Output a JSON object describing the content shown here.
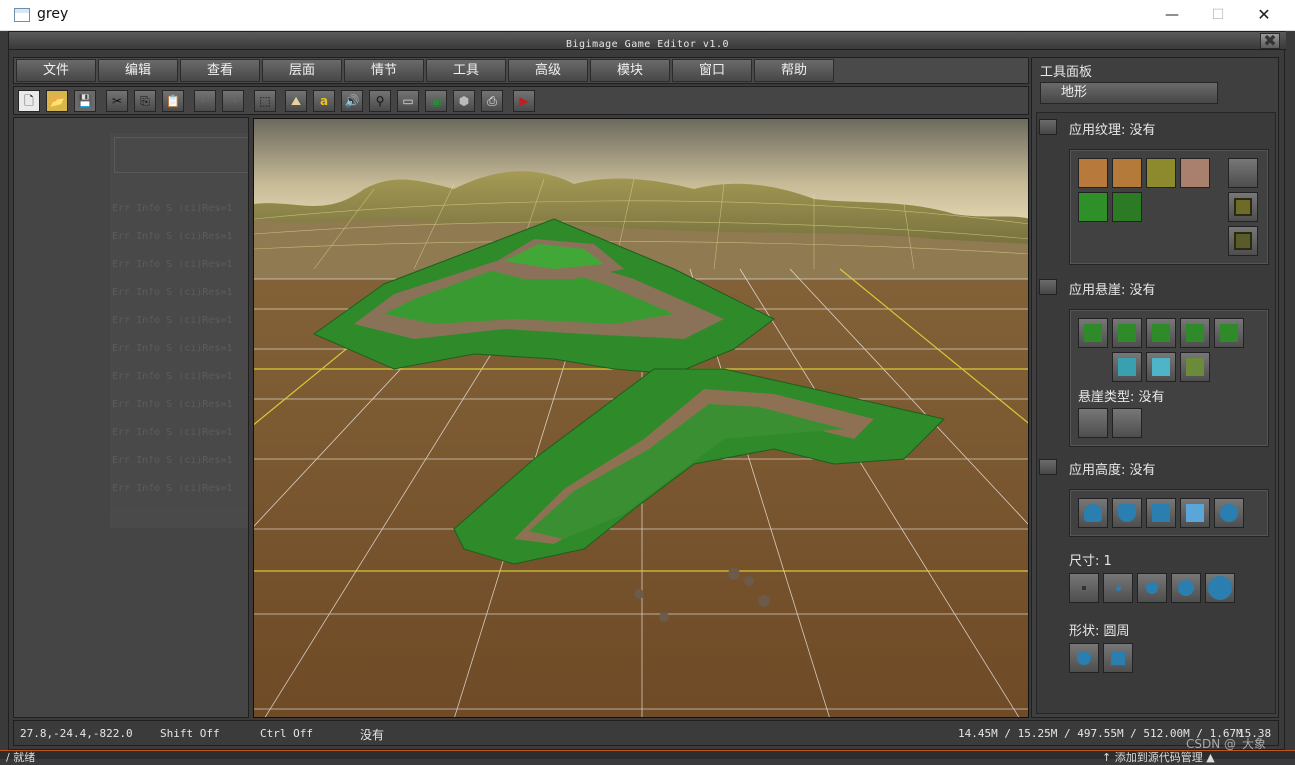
{
  "window": {
    "title": "grey",
    "minimize": "—",
    "maximize": "☐",
    "close": "✕"
  },
  "editor": {
    "title": "Bigimage Game Editor v1.0",
    "close": "✖"
  },
  "menu": [
    "文件",
    "编辑",
    "查看",
    "层面",
    "情节",
    "工具",
    "高级",
    "模块",
    "窗口",
    "帮助"
  ],
  "toolbar": [
    {
      "name": "new-icon",
      "glyph": "🗋"
    },
    {
      "name": "open-icon",
      "glyph": "📂"
    },
    {
      "name": "save-icon",
      "glyph": "💾"
    },
    {
      "name": "cut-icon",
      "glyph": "✂"
    },
    {
      "name": "copy-icon",
      "glyph": "⎘"
    },
    {
      "name": "paste-icon",
      "glyph": "📋"
    },
    {
      "name": "undo-icon",
      "glyph": "↶"
    },
    {
      "name": "redo-icon",
      "glyph": "↷"
    },
    {
      "name": "select-icon",
      "glyph": "⬚"
    },
    {
      "name": "terrain-icon",
      "glyph": "⛰"
    },
    {
      "name": "text-icon",
      "glyph": "a"
    },
    {
      "name": "sound-icon",
      "glyph": "🔊"
    },
    {
      "name": "unit-icon",
      "glyph": "⚲"
    },
    {
      "name": "camera-icon",
      "glyph": "▭"
    },
    {
      "name": "region-icon",
      "glyph": "▣"
    },
    {
      "name": "doodad-icon",
      "glyph": "⬢"
    },
    {
      "name": "export-icon",
      "glyph": "⎙"
    },
    {
      "name": "test-map-icon",
      "glyph": "▶"
    }
  ],
  "left_log": {
    "lines": [
      "Err Info  S  (ci)Res=1",
      "Err Info  S  (ci)Res=1",
      "Err Info  S  (ci)Res=1",
      "Err Info  S  (ci)Res=1",
      "Err Info  S  (ci)Res=1",
      "Err Info  S  (ci)Res=1",
      "Err Info  S  (ci)Res=1",
      "Err Info  S  (ci)Res=1",
      "Err Info  S  (ci)Res=1",
      "Err Info  S  (ci)Res=1",
      "Err Info  S  (ci)Res=1"
    ]
  },
  "tool_panel": {
    "title": "工具面板",
    "tab": "地形",
    "texture_label": "应用纹理: 没有",
    "cliff_label": "应用悬崖: 没有",
    "cliff_type_label": "悬崖类型: 没有",
    "height_label": "应用高度: 没有",
    "size_label": "尺寸: 1",
    "shape_label": "形状: 圆周",
    "texture_colors": [
      "#b87a3c",
      "#b47a3a",
      "#8d8a2e",
      "#a9806d",
      "#2f8f28",
      "#2c7a23"
    ],
    "accent": "#2a7fb0"
  },
  "status": {
    "coords": "27.8,-24.4,-822.0",
    "shift": "Shift Off",
    "ctrl": "Ctrl Off",
    "mode": "没有",
    "memory": "14.45M / 15.25M / 497.55M / 512.00M / 1.67M",
    "fps": "15.38"
  },
  "bottom": {
    "left": "/ 就绪",
    "right": "↑ 添加到源代码管理 ▲"
  },
  "watermark": "CSDN @_大象_"
}
